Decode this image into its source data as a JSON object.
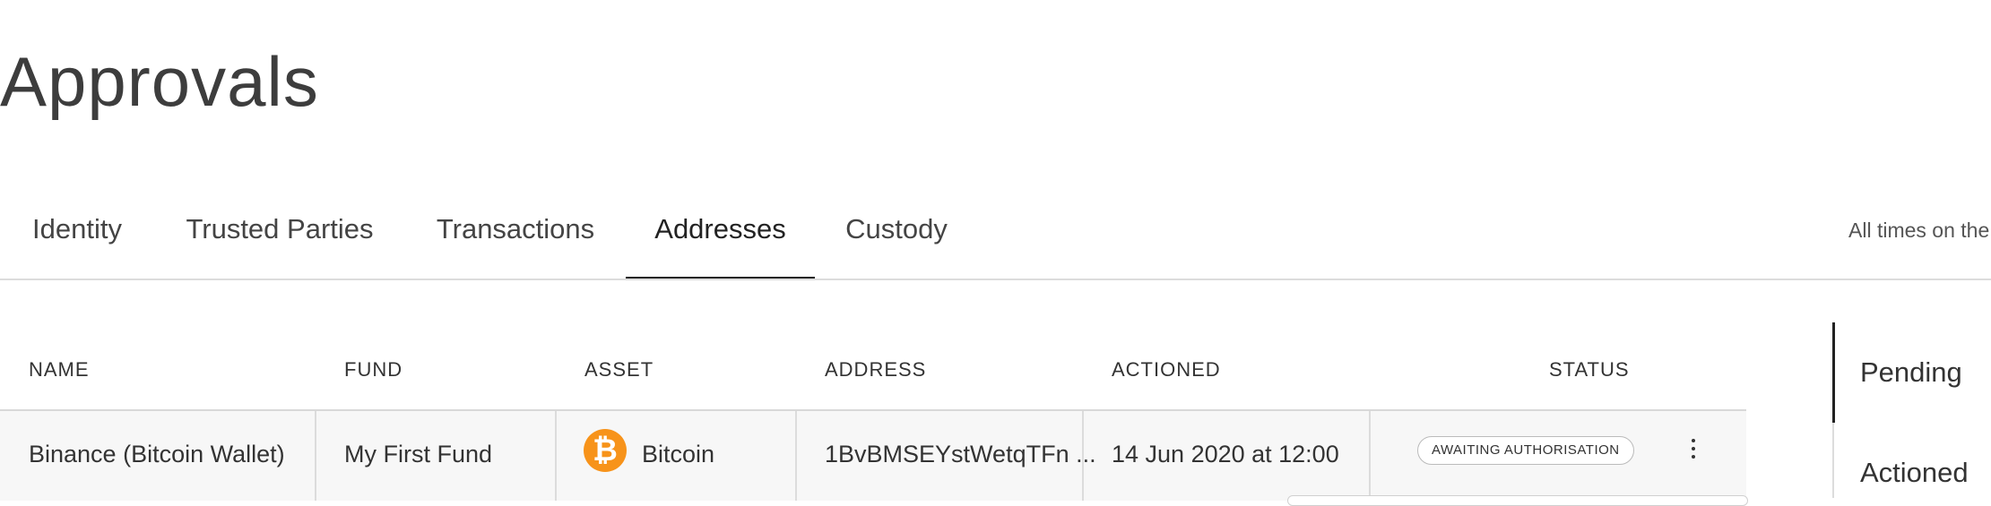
{
  "page": {
    "title": "Approvals"
  },
  "tabs": [
    {
      "label": "Identity"
    },
    {
      "label": "Trusted Parties"
    },
    {
      "label": "Transactions"
    },
    {
      "label": "Addresses",
      "active": true
    },
    {
      "label": "Custody"
    }
  ],
  "timezone_note": "All times on the",
  "table": {
    "headers": [
      "NAME",
      "FUND",
      "ASSET",
      "ADDRESS",
      "ACTIONED",
      "STATUS"
    ],
    "rows": [
      {
        "name": "Binance (Bitcoin Wallet)",
        "fund": "My First Fund",
        "asset": "Bitcoin",
        "asset_icon": "bitcoin-icon",
        "asset_glyph": "₿",
        "address": "1BvBMSEYstWetqTFn ...",
        "actioned": "14 Jun 2020 at 12:00",
        "status": "AWAITING AUTHORISATION"
      }
    ]
  },
  "side_filter": {
    "items": [
      {
        "label": "Pending",
        "active": true
      },
      {
        "label": "Actioned"
      }
    ]
  },
  "colors": {
    "bitcoin": "#f7931a",
    "active_tab": "#222222"
  }
}
